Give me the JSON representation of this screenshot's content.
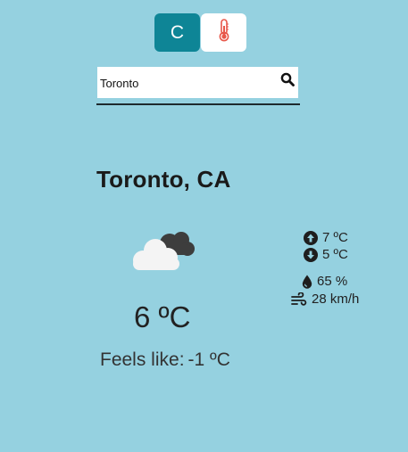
{
  "unit_toggle": {
    "celsius_label": "C",
    "fahrenheit_icon": "thermometer-icon",
    "active": "celsius",
    "accent": "#0e8596"
  },
  "search": {
    "value": "Toronto",
    "icon": "search-icon"
  },
  "weather": {
    "location": "Toronto, CA",
    "condition_icon": "cloudy-icon",
    "temperature": "6 ºC",
    "feels_like_label": "Feels like:",
    "feels_like_value": "-1 ºC",
    "high": "7 ºC",
    "low": "5 ºC",
    "humidity": "65 %",
    "wind": "28 km/h"
  },
  "colors": {
    "background": "#95d1e0",
    "thermometer": "#e8574a"
  }
}
